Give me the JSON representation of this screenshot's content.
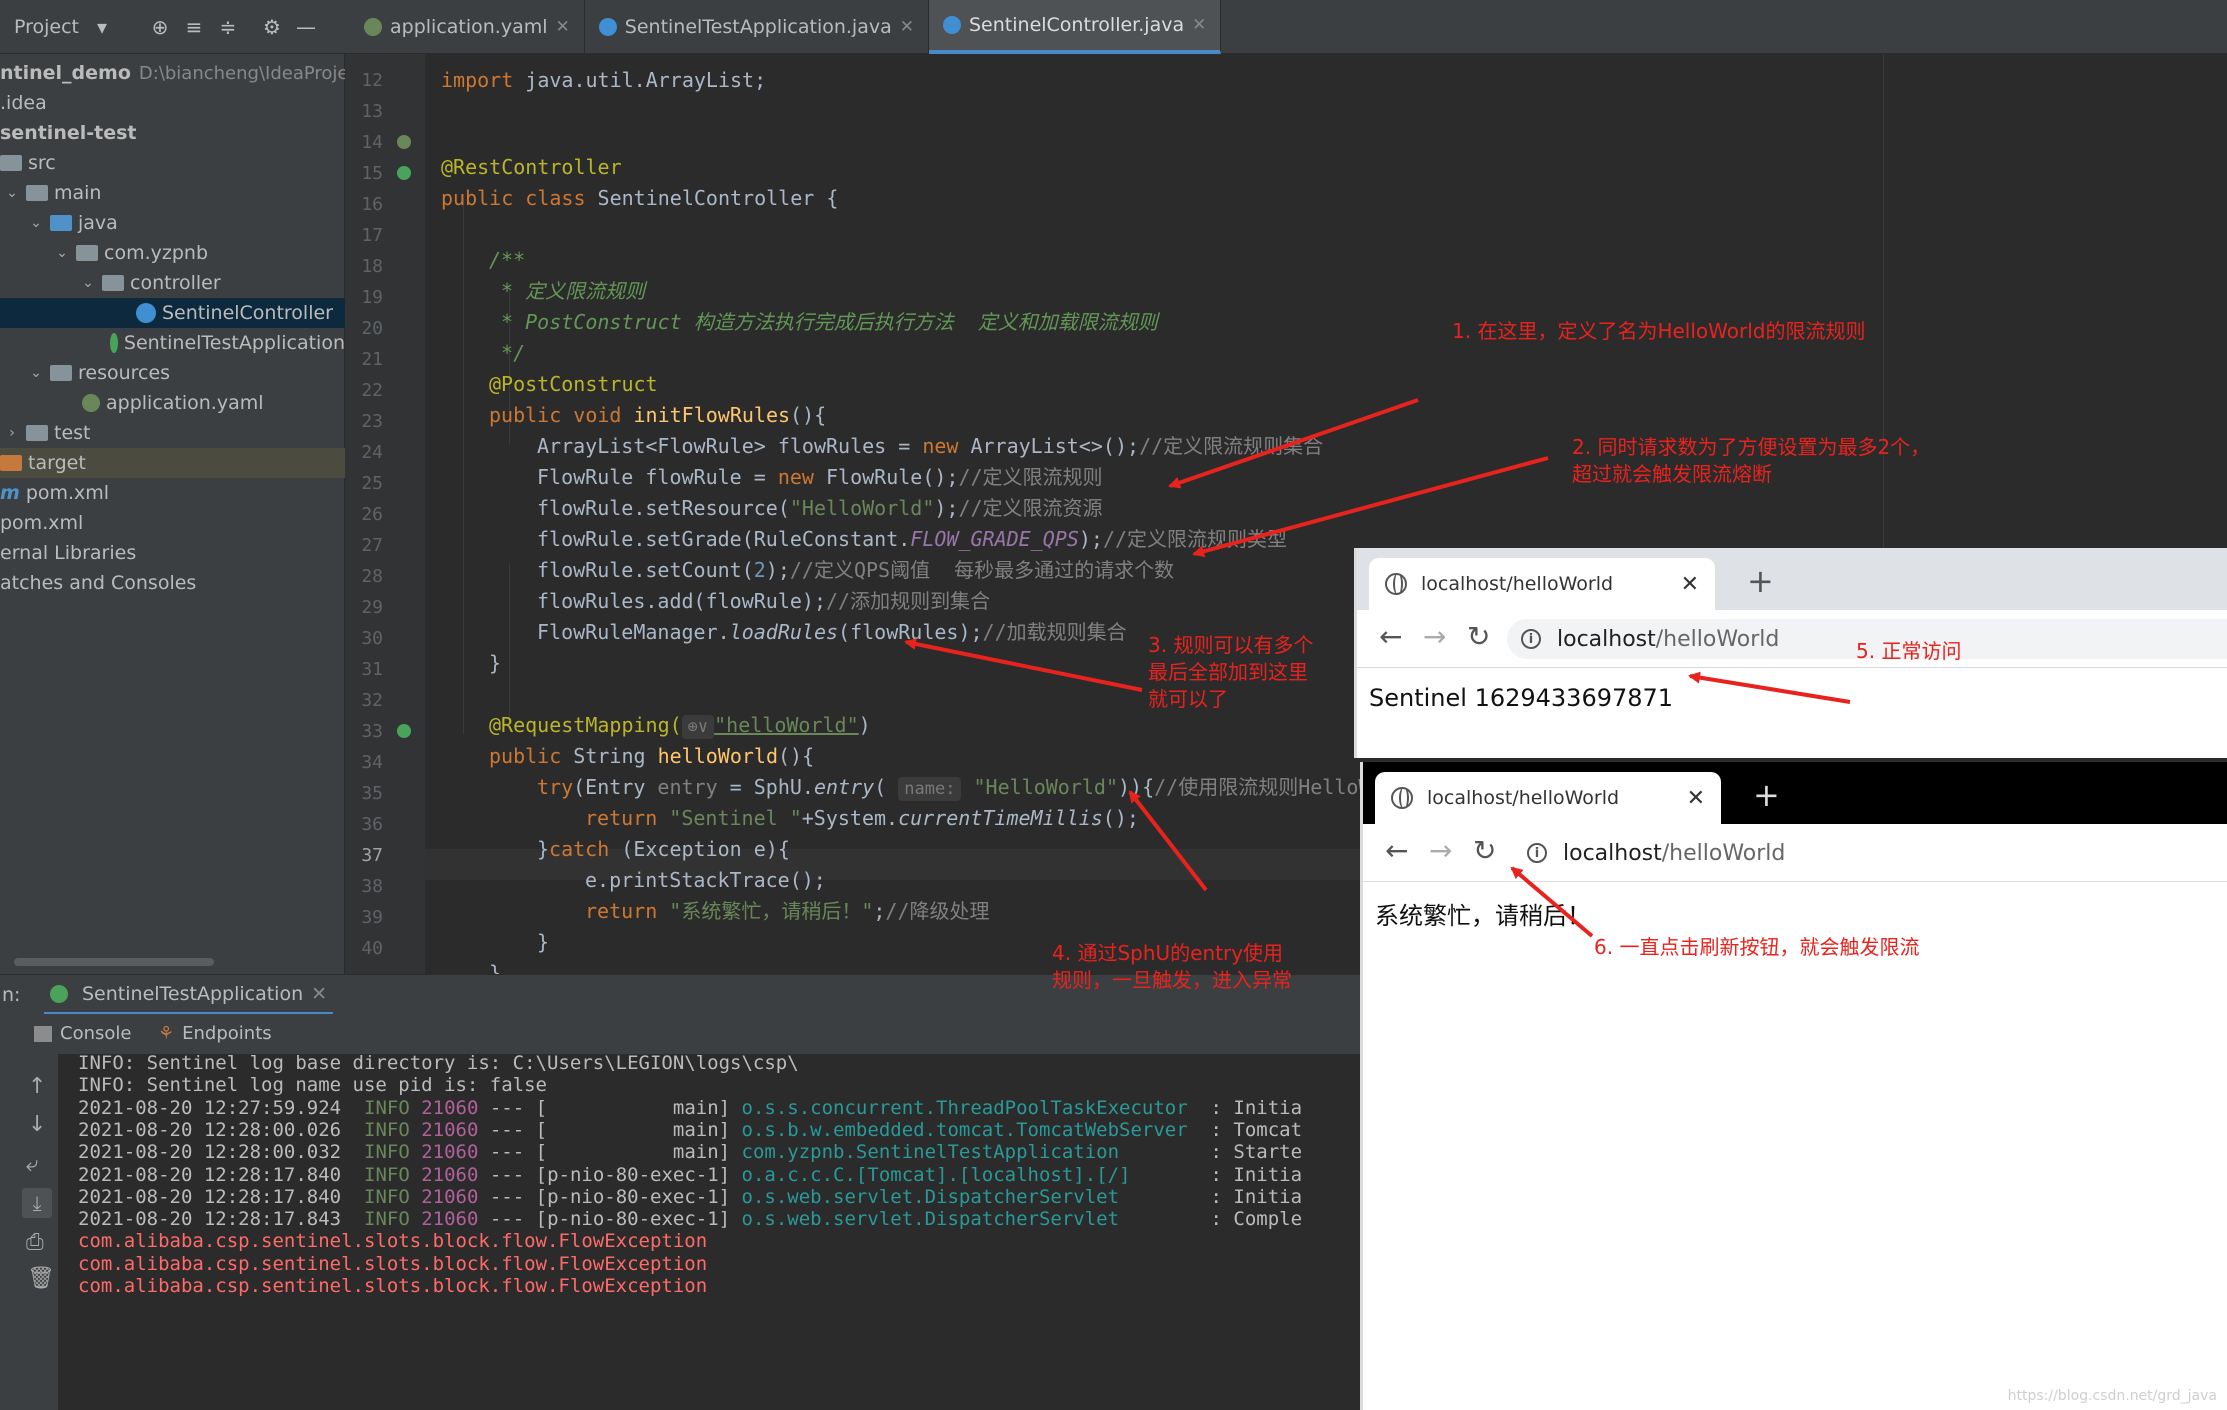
{
  "project_panel": {
    "title": "Project",
    "tree": [
      {
        "label": "ntinel_demo",
        "extra": "D:\\biancheng\\IdeaProjects\\",
        "bold": true
      },
      {
        "label": ".idea"
      },
      {
        "label": "sentinel-test",
        "bold": true
      },
      {
        "label": "src"
      },
      {
        "label": "main"
      },
      {
        "label": "java"
      },
      {
        "label": "com.yzpnb"
      },
      {
        "label": "controller"
      },
      {
        "label": "SentinelController"
      },
      {
        "label": "SentinelTestApplication"
      },
      {
        "label": "resources"
      },
      {
        "label": "application.yaml"
      },
      {
        "label": "test"
      },
      {
        "label": "target"
      },
      {
        "label": "pom.xml"
      },
      {
        "label": "pom.xml"
      },
      {
        "label": "ernal Libraries"
      },
      {
        "label": "atches and Consoles"
      }
    ]
  },
  "editor_tabs": [
    {
      "label": "application.yaml"
    },
    {
      "label": "SentinelTestApplication.java"
    },
    {
      "label": "SentinelController.java",
      "active": true
    }
  ],
  "code": {
    "line_numbers": [
      "12",
      "13",
      "14",
      "15",
      "16",
      "17",
      "18",
      "19",
      "20",
      "21",
      "22",
      "23",
      "24",
      "25",
      "26",
      "27",
      "28",
      "29",
      "30",
      "31",
      "32",
      "33",
      "34",
      "35",
      "36",
      "37",
      "38",
      "39",
      "40"
    ],
    "current_line": "37",
    "line12_kw": "import",
    "line12_rest": " java.util.ArrayList;",
    "line14": "@RestController",
    "line15_kw": "public class",
    "line15_rest": " SentinelController {",
    "line17": "/**",
    "line18": " * 定义限流规则",
    "line19": " * PostConstruct 构造方法执行完成后执行方法  定义和加载限流规则",
    "line20": " */",
    "line21": "@PostConstruct",
    "line22_kw": "public void",
    "line22_name": " initFlowRules",
    "line22_rest": "(){",
    "line23_a": "ArrayList<FlowRule> flowRules = ",
    "line23_kw": "new",
    "line23_b": " ArrayList<>();",
    "line23_c": "//定义限流规则集合",
    "line24_a": "FlowRule flowRule = ",
    "line24_kw": "new",
    "line24_b": " FlowRule();",
    "line24_c": "//定义限流规则",
    "line25_a": "flowRule.setResource(",
    "line25_s": "\"HelloWorld\"",
    "line25_b": ");",
    "line25_c": "//定义限流资源",
    "line26_a": "flowRule.setGrade(RuleConstant.",
    "line26_k": "FLOW_GRADE_QPS",
    "line26_b": ");",
    "line26_c": "//定义限流规则类型",
    "line27_a": "flowRule.setCount(",
    "line27_n": "2",
    "line27_b": ");",
    "line27_c": "//定义QPS阈值  每秒最多通过的请求个数",
    "line28_a": "flowRules.add(flowRule);",
    "line28_c": "//添加规则到集合",
    "line29_a": "FlowRuleManager.",
    "line29_i": "loadRules",
    "line29_b": "(flowRules);",
    "line29_c": "//加载规则集合",
    "line30": "}",
    "line32_a": "@RequestMapping(",
    "line32_hint": "⊕∨",
    "line32_s": "\"helloWorld\"",
    "line32_b": ")",
    "line33_kw": "public",
    "line33_a": " String ",
    "line33_name": "helloWorld",
    "line33_b": "(){",
    "line34_kw": "try",
    "line34_a": "(Entry ",
    "line34_v": "entry",
    "line34_b": " = SphU.",
    "line34_i": "entry",
    "line34_c": "( ",
    "line34_hint": "name:",
    "line34_s": " \"HelloWorld\"",
    "line34_d": ")){",
    "line34_cm": "//使用限流规则HelloWo",
    "line35_kw": "return",
    "line35_s": " \"Sentinel \"",
    "line35_a": "+System.",
    "line35_i": "currentTimeMillis",
    "line35_b": "();",
    "line36_a": "}",
    "line36_kw": "catch",
    "line36_b": " (Exception e){",
    "line37": "e.printStackTrace();",
    "line38_kw": "return",
    "line38_s": " \"系统繁忙，请稍后！\"",
    "line38_b": ";",
    "line38_c": "//降级处理",
    "line39": "}",
    "line40": "}"
  },
  "run_panel": {
    "prefix": "n:",
    "app_tab": "SentinelTestApplication",
    "console_tab": "Console",
    "endpoints_tab": "Endpoints",
    "lines": [
      {
        "plain": "INFO: Sentinel log base directory is: C:\\Users\\LEGION\\logs\\csp\\"
      },
      {
        "plain": "INFO: Sentinel log name use pid is: false"
      },
      {
        "ts": "2021-08-20 12:27:59.924",
        "lvl": "INFO",
        "pid": "21060",
        "sep": " --- ",
        "th": "[           main]",
        "lg": "o.s.s.concurrent.ThreadPoolTaskExecutor",
        "msg": "  : Initia"
      },
      {
        "ts": "2021-08-20 12:28:00.026",
        "lvl": "INFO",
        "pid": "21060",
        "sep": " --- ",
        "th": "[           main]",
        "lg": "o.s.b.w.embedded.tomcat.TomcatWebServer",
        "msg": "  : Tomcat"
      },
      {
        "ts": "2021-08-20 12:28:00.032",
        "lvl": "INFO",
        "pid": "21060",
        "sep": " --- ",
        "th": "[           main]",
        "lg": "com.yzpnb.SentinelTestApplication      ",
        "msg": "  : Starte"
      },
      {
        "ts": "2021-08-20 12:28:17.840",
        "lvl": "INFO",
        "pid": "21060",
        "sep": " --- ",
        "th": "[p-nio-80-exec-1]",
        "lg": "o.a.c.c.C.[Tomcat].[localhost].[/]     ",
        "msg": "  : Initia"
      },
      {
        "ts": "2021-08-20 12:28:17.840",
        "lvl": "INFO",
        "pid": "21060",
        "sep": " --- ",
        "th": "[p-nio-80-exec-1]",
        "lg": "o.s.web.servlet.DispatcherServlet      ",
        "msg": "  : Initia"
      },
      {
        "ts": "2021-08-20 12:28:17.843",
        "lvl": "INFO",
        "pid": "21060",
        "sep": " --- ",
        "th": "[p-nio-80-exec-1]",
        "lg": "o.s.web.servlet.DispatcherServlet      ",
        "msg": "  : Comple"
      },
      {
        "err": "com.alibaba.csp.sentinel.slots.block.flow.FlowException"
      },
      {
        "err": "com.alibaba.csp.sentinel.slots.block.flow.FlowException"
      },
      {
        "err": "com.alibaba.csp.sentinel.slots.block.flow.FlowException"
      }
    ]
  },
  "browser1": {
    "tab_title": "localhost/helloWorld",
    "url_host": "localhost",
    "url_path": "/helloWorld",
    "body": "Sentinel 1629433697871"
  },
  "browser2": {
    "tab_title": "localhost/helloWorld",
    "url_host": "localhost",
    "url_path": "/helloWorld",
    "body": "系统繁忙，请稍后！"
  },
  "annotations": {
    "a1": "1. 在这里，定义了名为HelloWorld的限流规则",
    "a2": "2. 同时请求数为了方便设置为最多2个，\n超过就会触发限流熔断",
    "a3": "3. 规则可以有多个\n最后全部加到这里\n就可以了",
    "a4": "4. 通过SphU的entry使用\n规则，一旦触发，进入异常",
    "a5": "5. 正常访问",
    "a6": "6. 一直点击刷新按钮，就会触发限流"
  },
  "watermark": "https://blog.csdn.net/grd_java",
  "colors": {
    "annotation": "#e8231e",
    "editor_bg": "#2b2b2b",
    "panel_bg": "#3c3f41",
    "selection": "#0d293e"
  }
}
